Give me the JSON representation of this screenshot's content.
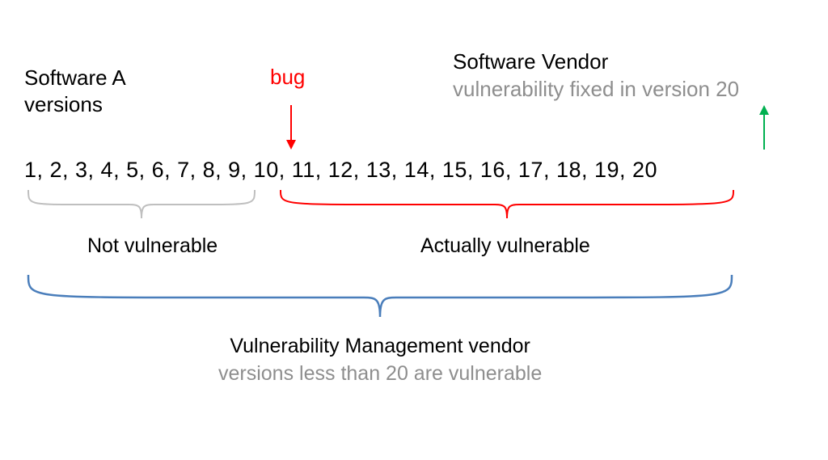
{
  "labels": {
    "software_a_line1": "Software A",
    "software_a_line2": "versions",
    "bug": "bug",
    "vendor_title": "Software Vendor",
    "vendor_sub": "vulnerability fixed in version 20",
    "not_vulnerable": "Not vulnerable",
    "actually_vulnerable": "Actually vulnerable",
    "vm_title": "Vulnerability Management vendor",
    "vm_sub": "versions less than 20 are vulnerable"
  },
  "versions": "1, 2, 3, 4, 5, 6, 7, 8, 9, 10, 11, 12, 13, 14, 15, 16, 17, 18, 19, 20",
  "colors": {
    "red": "#ff0000",
    "green": "#00b050",
    "gray_brace": "#bfbfbf",
    "red_brace": "#ff0000",
    "blue_brace": "#4a7ebb"
  },
  "chart_data": {
    "type": "table",
    "title": "Software version vulnerability ranges",
    "versions_all": [
      1,
      2,
      3,
      4,
      5,
      6,
      7,
      8,
      9,
      10,
      11,
      12,
      13,
      14,
      15,
      16,
      17,
      18,
      19,
      20
    ],
    "bug_introduced_at": 10,
    "fixed_at": 20,
    "ranges": {
      "not_vulnerable": {
        "from": 1,
        "to": 9
      },
      "actually_vulnerable": {
        "from": 10,
        "to": 19
      },
      "vm_vendor_claims_vulnerable": {
        "from": 1,
        "to": 19
      }
    },
    "annotations": {
      "software_vendor": "vulnerability fixed in version 20",
      "vm_vendor": "versions less than 20 are vulnerable"
    }
  }
}
